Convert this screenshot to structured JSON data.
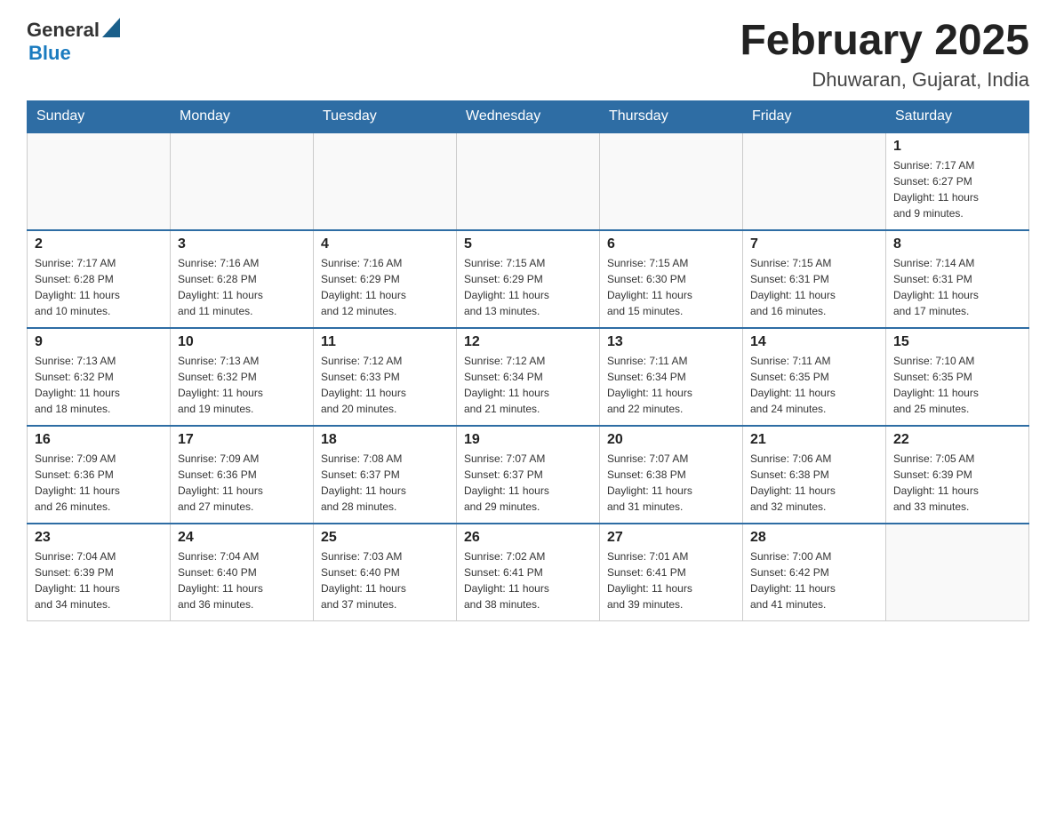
{
  "header": {
    "logo_general": "General",
    "logo_blue": "Blue",
    "title": "February 2025",
    "subtitle": "Dhuwaran, Gujarat, India"
  },
  "days_of_week": [
    "Sunday",
    "Monday",
    "Tuesday",
    "Wednesday",
    "Thursday",
    "Friday",
    "Saturday"
  ],
  "weeks": [
    [
      {
        "day": "",
        "info": ""
      },
      {
        "day": "",
        "info": ""
      },
      {
        "day": "",
        "info": ""
      },
      {
        "day": "",
        "info": ""
      },
      {
        "day": "",
        "info": ""
      },
      {
        "day": "",
        "info": ""
      },
      {
        "day": "1",
        "info": "Sunrise: 7:17 AM\nSunset: 6:27 PM\nDaylight: 11 hours\nand 9 minutes."
      }
    ],
    [
      {
        "day": "2",
        "info": "Sunrise: 7:17 AM\nSunset: 6:28 PM\nDaylight: 11 hours\nand 10 minutes."
      },
      {
        "day": "3",
        "info": "Sunrise: 7:16 AM\nSunset: 6:28 PM\nDaylight: 11 hours\nand 11 minutes."
      },
      {
        "day": "4",
        "info": "Sunrise: 7:16 AM\nSunset: 6:29 PM\nDaylight: 11 hours\nand 12 minutes."
      },
      {
        "day": "5",
        "info": "Sunrise: 7:15 AM\nSunset: 6:29 PM\nDaylight: 11 hours\nand 13 minutes."
      },
      {
        "day": "6",
        "info": "Sunrise: 7:15 AM\nSunset: 6:30 PM\nDaylight: 11 hours\nand 15 minutes."
      },
      {
        "day": "7",
        "info": "Sunrise: 7:15 AM\nSunset: 6:31 PM\nDaylight: 11 hours\nand 16 minutes."
      },
      {
        "day": "8",
        "info": "Sunrise: 7:14 AM\nSunset: 6:31 PM\nDaylight: 11 hours\nand 17 minutes."
      }
    ],
    [
      {
        "day": "9",
        "info": "Sunrise: 7:13 AM\nSunset: 6:32 PM\nDaylight: 11 hours\nand 18 minutes."
      },
      {
        "day": "10",
        "info": "Sunrise: 7:13 AM\nSunset: 6:32 PM\nDaylight: 11 hours\nand 19 minutes."
      },
      {
        "day": "11",
        "info": "Sunrise: 7:12 AM\nSunset: 6:33 PM\nDaylight: 11 hours\nand 20 minutes."
      },
      {
        "day": "12",
        "info": "Sunrise: 7:12 AM\nSunset: 6:34 PM\nDaylight: 11 hours\nand 21 minutes."
      },
      {
        "day": "13",
        "info": "Sunrise: 7:11 AM\nSunset: 6:34 PM\nDaylight: 11 hours\nand 22 minutes."
      },
      {
        "day": "14",
        "info": "Sunrise: 7:11 AM\nSunset: 6:35 PM\nDaylight: 11 hours\nand 24 minutes."
      },
      {
        "day": "15",
        "info": "Sunrise: 7:10 AM\nSunset: 6:35 PM\nDaylight: 11 hours\nand 25 minutes."
      }
    ],
    [
      {
        "day": "16",
        "info": "Sunrise: 7:09 AM\nSunset: 6:36 PM\nDaylight: 11 hours\nand 26 minutes."
      },
      {
        "day": "17",
        "info": "Sunrise: 7:09 AM\nSunset: 6:36 PM\nDaylight: 11 hours\nand 27 minutes."
      },
      {
        "day": "18",
        "info": "Sunrise: 7:08 AM\nSunset: 6:37 PM\nDaylight: 11 hours\nand 28 minutes."
      },
      {
        "day": "19",
        "info": "Sunrise: 7:07 AM\nSunset: 6:37 PM\nDaylight: 11 hours\nand 29 minutes."
      },
      {
        "day": "20",
        "info": "Sunrise: 7:07 AM\nSunset: 6:38 PM\nDaylight: 11 hours\nand 31 minutes."
      },
      {
        "day": "21",
        "info": "Sunrise: 7:06 AM\nSunset: 6:38 PM\nDaylight: 11 hours\nand 32 minutes."
      },
      {
        "day": "22",
        "info": "Sunrise: 7:05 AM\nSunset: 6:39 PM\nDaylight: 11 hours\nand 33 minutes."
      }
    ],
    [
      {
        "day": "23",
        "info": "Sunrise: 7:04 AM\nSunset: 6:39 PM\nDaylight: 11 hours\nand 34 minutes."
      },
      {
        "day": "24",
        "info": "Sunrise: 7:04 AM\nSunset: 6:40 PM\nDaylight: 11 hours\nand 36 minutes."
      },
      {
        "day": "25",
        "info": "Sunrise: 7:03 AM\nSunset: 6:40 PM\nDaylight: 11 hours\nand 37 minutes."
      },
      {
        "day": "26",
        "info": "Sunrise: 7:02 AM\nSunset: 6:41 PM\nDaylight: 11 hours\nand 38 minutes."
      },
      {
        "day": "27",
        "info": "Sunrise: 7:01 AM\nSunset: 6:41 PM\nDaylight: 11 hours\nand 39 minutes."
      },
      {
        "day": "28",
        "info": "Sunrise: 7:00 AM\nSunset: 6:42 PM\nDaylight: 11 hours\nand 41 minutes."
      },
      {
        "day": "",
        "info": ""
      }
    ]
  ]
}
